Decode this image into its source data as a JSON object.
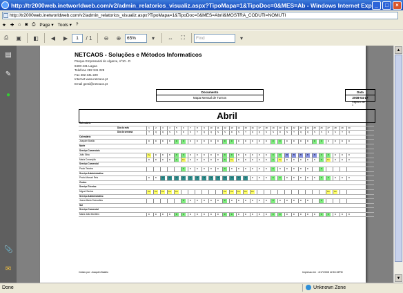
{
  "window": {
    "title": "http://tr2000web.inetworldweb.com/v2/admin_relatorios_visualiz.aspx?TipoMapa=1&TipoDoc=0&MES=Ab - Windows Internet Explorer"
  },
  "address": {
    "url": "http://tr2000web.inetworldweb.com/v2/admin_relatorios_visualiz.aspx?TipoMapa=1&TipoDoc=0&MES=Abril&MOSTRA_CODUTI=NOMUTI"
  },
  "favbar": {
    "page_label": "Page",
    "tools_label": "Tools"
  },
  "pdf": {
    "page_input": "1",
    "page_total": "/ 1",
    "zoom": "65%",
    "find_placeholder": "Find"
  },
  "report": {
    "company": "NETCAOS - Soluções e Métodos Informaticos",
    "address_lines": [
      "Parque Empresarial do Algarve, nº10 - D",
      "8400-431     Lagoa",
      "Telefone      282 341 228",
      "Fax            282 341 229",
      "Internet       www.netcaos.pt",
      "Email         geral@netcaos.pt"
    ],
    "doc_header": "Documento",
    "doc_value": "Mapa Mensal de Turnos",
    "date_header": "Data",
    "date_value": "2008-04-17",
    "page_num": "Página 1 de 1",
    "month": "Abril",
    "footer_left": "Criado por:    Joaquim Basilio",
    "footer_right": "Impresso em : 4/17/2008  12:53:15PM"
  },
  "grid": {
    "day_numbers": [
      "1",
      "2",
      "3",
      "4",
      "5",
      "6",
      "7",
      "8",
      "9",
      "10",
      "11",
      "12",
      "13",
      "14",
      "15",
      "16",
      "17",
      "18",
      "19",
      "20",
      "21",
      "22",
      "23",
      "24",
      "25",
      "26",
      "27",
      "28",
      "29",
      "30"
    ],
    "weekdays": [
      "T",
      "Q",
      "Q",
      "S",
      "S",
      "D",
      "S",
      "T",
      "Q",
      "Q",
      "S",
      "S",
      "D",
      "S",
      "T",
      "Q",
      "Q",
      "S",
      "S",
      "D",
      "S",
      "T",
      "Q",
      "Q",
      "S",
      "S",
      "D",
      "S",
      "T",
      "Q"
    ],
    "rows": [
      {
        "label": "Calendário",
        "kind": "section"
      },
      {
        "label": "Dia do mês",
        "kind": "days"
      },
      {
        "label": "Dia da semana",
        "kind": "weekdays"
      },
      {
        "label": "Calendário",
        "kind": "section"
      },
      {
        "label": "Joaquim Basilio",
        "kind": "shifts",
        "cells": [
          "D",
          "D",
          "D",
          "D",
          "F",
          "F",
          "D",
          "D",
          "D",
          "D",
          "D",
          "F",
          "F",
          "D",
          "D",
          "D",
          "D",
          "D",
          "F",
          "F",
          "D",
          "D",
          "D",
          "D",
          "F",
          "F",
          "D",
          "D",
          "D",
          "D"
        ]
      },
      {
        "label": "Norte",
        "kind": "section"
      },
      {
        "label": "Serviço Comerciais",
        "kind": "section"
      },
      {
        "label": "João Silva",
        "kind": "shifts",
        "cells": [
          "Fe",
          "D",
          "D",
          "D",
          "F",
          "F",
          "D",
          "D",
          "D",
          "D",
          "D",
          "F",
          "F",
          "D",
          "D",
          "D",
          "D",
          "D",
          "F",
          "F",
          "B",
          "B",
          "B",
          "B",
          "B",
          "F",
          "F",
          "D",
          "D",
          "D"
        ]
      },
      {
        "label": "Maria Conceição",
        "kind": "shifts",
        "cells": [
          "D",
          "D",
          "D",
          "D",
          "F",
          "Fe",
          "D",
          "D",
          "D",
          "D",
          "D",
          "F",
          "Fe",
          "D",
          "D",
          "D",
          "D",
          "D",
          "F",
          "Fe",
          "D",
          "D",
          "D",
          "D",
          "D",
          "F",
          "Fe",
          "D",
          "D",
          "D"
        ]
      },
      {
        "label": "Serviço Comercial",
        "kind": "section"
      },
      {
        "label": "Paulo Teixeira",
        "kind": "shifts",
        "cells": [
          "",
          "",
          "",
          "",
          "",
          "F",
          "D",
          "D",
          "D",
          "D",
          "D",
          "F",
          "D",
          "D",
          "D",
          "D",
          "D",
          "D",
          "F",
          "D",
          "D",
          "D",
          "D",
          "D",
          "",
          "F",
          "",
          "",
          "",
          ""
        ]
      },
      {
        "label": "Serviço Administrativo",
        "kind": "section"
      },
      {
        "label": "Pedro Manuel Reis",
        "kind": "shifts",
        "cells": [
          "D",
          "D",
          "T",
          "T",
          "T",
          "T",
          "T",
          "T",
          "T",
          "T",
          "T",
          "T",
          "T",
          "T",
          "T",
          "D",
          "D",
          "D",
          "F",
          "F",
          "D",
          "D",
          "D",
          "D",
          "D",
          "F",
          "F",
          "D",
          "D",
          "D"
        ]
      },
      {
        "label": "Centro",
        "kind": "section"
      },
      {
        "label": "Serviço Técnico",
        "kind": "section"
      },
      {
        "label": "Miguel Santos",
        "kind": "shifts",
        "cells": [
          "Fe",
          "Fe",
          "Fe",
          "Fe",
          "Fe",
          "",
          "",
          "",
          "",
          "",
          "",
          "Fe",
          "Fe",
          "Fe",
          "Fe",
          "Fe",
          "",
          "",
          "",
          "",
          "",
          "",
          "",
          "",
          "",
          "",
          "Fe",
          "Fe",
          "",
          ""
        ]
      },
      {
        "label": "Serviço Administrativo",
        "kind": "section"
      },
      {
        "label": "Joana Maria Guimarães",
        "kind": "shifts",
        "cells": [
          "",
          "",
          "",
          "",
          "",
          "F",
          "D",
          "D",
          "D",
          "D",
          "D",
          "F",
          "D",
          "D",
          "D",
          "D",
          "D",
          "D",
          "F",
          "D",
          "D",
          "D",
          "D",
          "D",
          "",
          "F",
          "",
          "",
          "",
          ""
        ]
      },
      {
        "label": "Sul",
        "kind": "section"
      },
      {
        "label": "Serviço Comercial",
        "kind": "section"
      },
      {
        "label": "Maria João Monteiro",
        "kind": "shifts",
        "cells": [
          "D",
          "D",
          "D",
          "D",
          "F",
          "F",
          "D",
          "D",
          "D",
          "D",
          "D",
          "F",
          "F",
          "D",
          "D",
          "D",
          "D",
          "D",
          "F",
          "F",
          "D",
          "D",
          "D",
          "D",
          "D",
          "F",
          "F",
          "D",
          "D",
          "D"
        ]
      }
    ]
  },
  "status": {
    "left": "Done",
    "zone": "Unknown Zone"
  },
  "colors": {
    "titlebar": "#1f57c8",
    "weekend": "#7dee7d",
    "holiday": "#ffff66",
    "training": "#2e8b8b",
    "block": "#8a96e8"
  }
}
